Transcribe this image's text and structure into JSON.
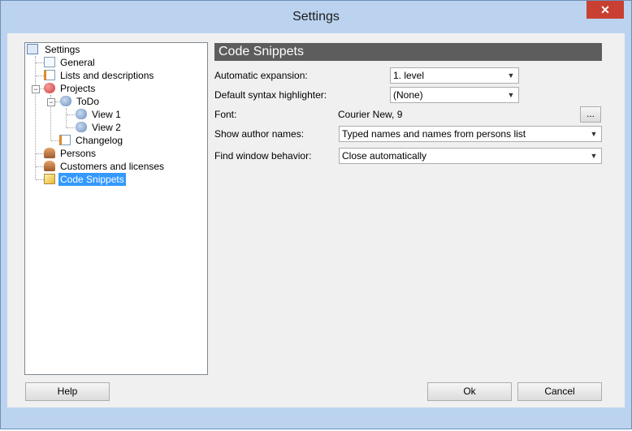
{
  "window": {
    "title": "Settings",
    "close_glyph": "✕"
  },
  "tree": {
    "items": [
      {
        "label": "Settings",
        "icon": "settings-icon",
        "pm": "−"
      },
      {
        "label": "General",
        "icon": "page-icon"
      },
      {
        "label": "Lists and descriptions",
        "icon": "list-icon"
      },
      {
        "label": "Projects",
        "icon": "projects-icon",
        "pm": "−"
      },
      {
        "label": "ToDo",
        "icon": "todo-icon",
        "pm": "−"
      },
      {
        "label": "View 1",
        "icon": "view-icon"
      },
      {
        "label": "View 2",
        "icon": "view-icon"
      },
      {
        "label": "Changelog",
        "icon": "changelog-icon"
      },
      {
        "label": "Persons",
        "icon": "persons-icon"
      },
      {
        "label": "Customers and licenses",
        "icon": "customers-icon"
      },
      {
        "label": "Code Snippets",
        "icon": "code-snippets-icon",
        "selected": true
      }
    ]
  },
  "panel": {
    "title": "Code Snippets",
    "automatic_expansion": {
      "label": "Automatic expansion:",
      "value": "1. level"
    },
    "syntax_highlighter": {
      "label": "Default syntax highlighter:",
      "value": "(None)"
    },
    "font": {
      "label": "Font:",
      "value": "Courier New, 9",
      "button": "..."
    },
    "author_names": {
      "label": "Show author names:",
      "value": "Typed names and names from persons list"
    },
    "find_window": {
      "label": "Find window behavior:",
      "value": "Close automatically"
    }
  },
  "buttons": {
    "help": "Help",
    "ok": "Ok",
    "cancel": "Cancel"
  }
}
